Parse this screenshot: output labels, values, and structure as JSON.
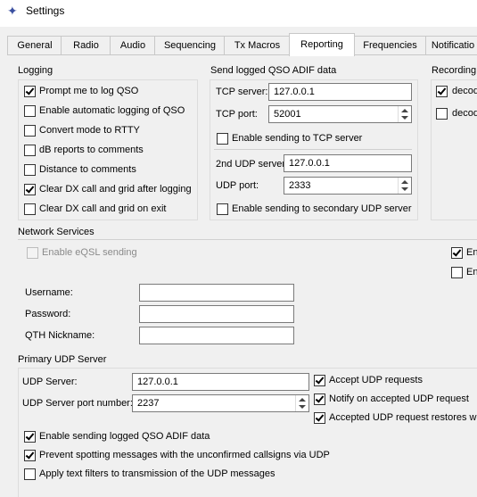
{
  "window": {
    "title": "Settings",
    "icon": "settings-app-icon"
  },
  "tabs": [
    {
      "label": "General",
      "active": false
    },
    {
      "label": "Radio",
      "active": false
    },
    {
      "label": "Audio",
      "active": false
    },
    {
      "label": "Sequencing",
      "active": false
    },
    {
      "label": "Tx Macros",
      "active": false
    },
    {
      "label": "Reporting",
      "active": true
    },
    {
      "label": "Frequencies",
      "active": false
    },
    {
      "label": "Notificatio",
      "active": false
    }
  ],
  "logging": {
    "title": "Logging",
    "items": [
      {
        "label": "Prompt me to log QSO",
        "checked": true
      },
      {
        "label": "Enable automatic logging of QSO",
        "checked": false
      },
      {
        "label": "Convert mode to RTTY",
        "checked": false
      },
      {
        "label": "dB reports to comments",
        "checked": false
      },
      {
        "label": "Distance to comments",
        "checked": false
      },
      {
        "label": "Clear DX call and grid after logging",
        "checked": true
      },
      {
        "label": "Clear DX call and grid on exit",
        "checked": false
      }
    ]
  },
  "adif": {
    "title": "Send logged QSO ADIF data",
    "tcp_server_label": "TCP server:",
    "tcp_server_value": "127.0.0.1",
    "tcp_port_label": "TCP port:",
    "tcp_port_value": "52001",
    "enable_tcp_label": "Enable sending to TCP server",
    "enable_tcp_checked": false,
    "udp2_server_label": "2nd UDP server",
    "udp2_server_value": "127.0.0.1",
    "udp2_port_label": "UDP port:",
    "udp2_port_value": "2333",
    "enable_udp2_label": "Enable sending to secondary UDP server",
    "enable_udp2_checked": false
  },
  "recording": {
    "title": "Recording",
    "items": [
      {
        "label": "decod",
        "checked": true
      },
      {
        "label": "decod",
        "checked": false
      }
    ]
  },
  "network": {
    "title": "Network Services",
    "eqsl_label": "Enable eQSL sending",
    "eqsl_checked": false,
    "right_items": [
      {
        "label": "En",
        "checked": true
      },
      {
        "label": "En",
        "checked": false
      }
    ],
    "username_label": "Username:",
    "username_value": "",
    "password_label": "Password:",
    "password_value": "",
    "qth_label": "QTH Nickname:",
    "qth_value": ""
  },
  "udp": {
    "title": "Primary UDP Server",
    "server_label": "UDP Server:",
    "server_value": "127.0.0.1",
    "port_label": "UDP Server port number:",
    "port_value": "2237",
    "accept_label": "Accept UDP requests",
    "accept_checked": true,
    "notify_label": "Notify on accepted UDP request",
    "notify_checked": true,
    "restores_label": "Accepted UDP request restores win",
    "restores_checked": true,
    "options": [
      {
        "label": "Enable sending logged QSO ADIF data",
        "checked": true
      },
      {
        "label": "Prevent spotting messages with the unconfirmed callsigns via UDP",
        "checked": true
      },
      {
        "label": "Apply text filters to transmission of the UDP messages",
        "checked": false
      }
    ]
  }
}
